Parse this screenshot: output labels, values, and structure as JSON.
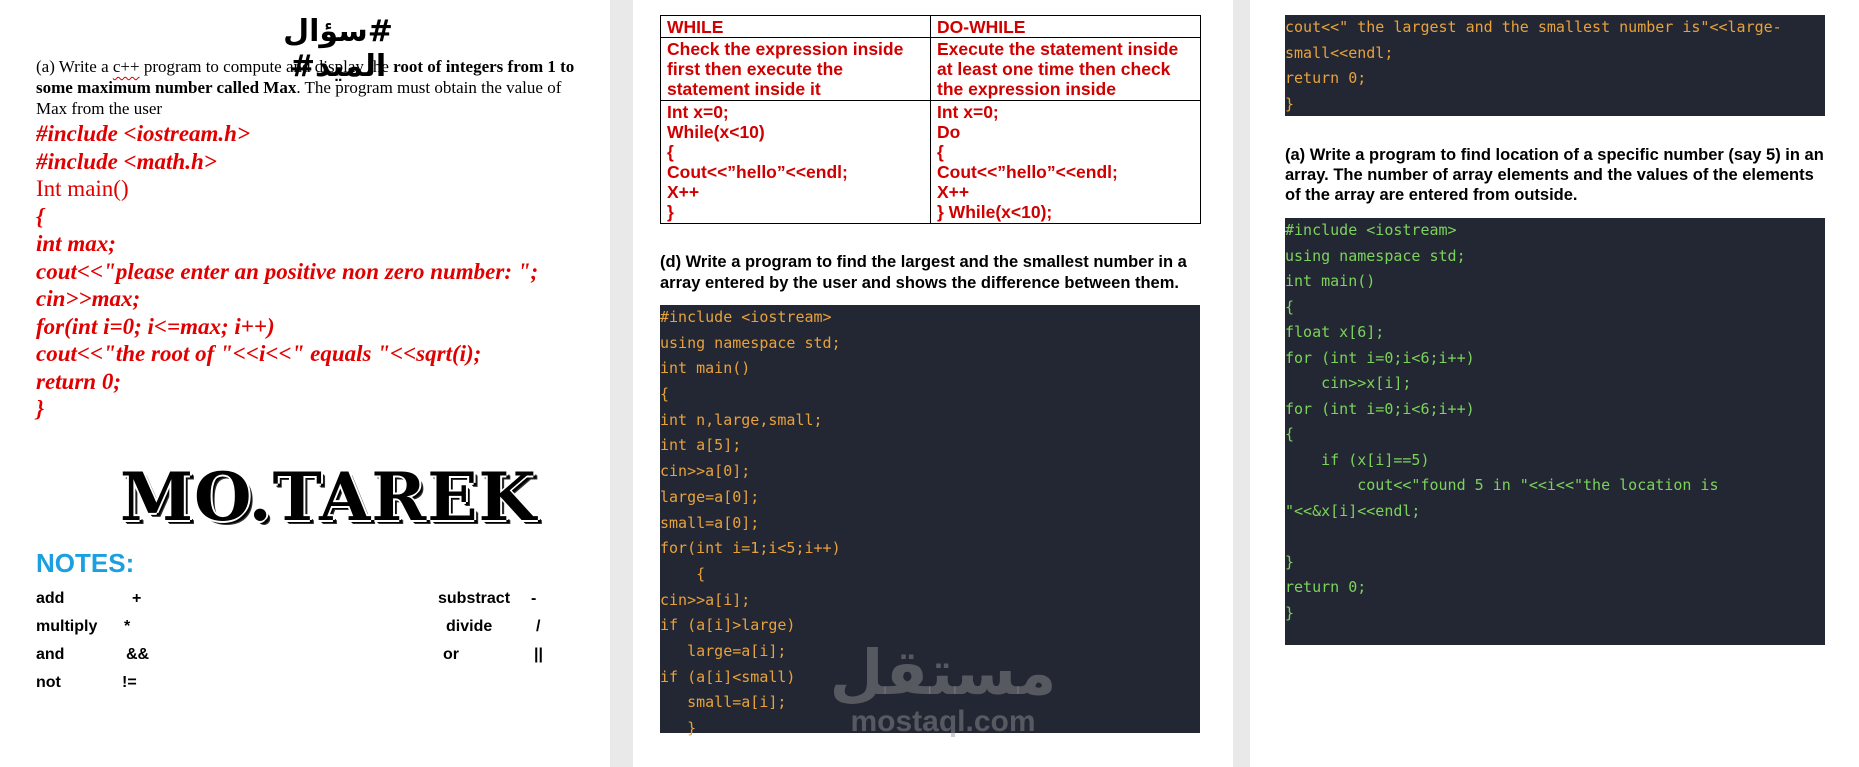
{
  "page1": {
    "arabic_title": "#سؤال الميد#",
    "question": {
      "part1": "(a) Write a ",
      "cpp": "c++",
      "part2": " program to compute and display the ",
      "bold1": "root of integers from 1 to some maximum number called Max",
      "part3": ". The program must obtain the value of Max from the user"
    },
    "code_lines": [
      "#include <iostream.h>",
      "#include <math.h>",
      "Int main()",
      "{",
      "int max;",
      "cout<<\"please enter an positive non zero number: \";",
      "cin>>max;",
      "for(int i=0; i<=max; i++)",
      "cout<<\"the root of \"<<i<<\" equals \"<<sqrt(i);",
      "return 0;",
      "}"
    ],
    "logo": "MO.TAREK",
    "notes_title": "NOTES:",
    "notes": [
      {
        "l1": "add",
        "s1": "+",
        "l2": "substract",
        "s2": "-"
      },
      {
        "l1": "multiply",
        "s1": "*",
        "l2": "divide",
        "s2": "/"
      },
      {
        "l1": "and",
        "s1": "&&",
        "l2": "or",
        "s2": "||"
      },
      {
        "l1": "not",
        "s1": "!=",
        "l2": "",
        "s2": ""
      }
    ]
  },
  "page2": {
    "table": {
      "headers": [
        "WHILE",
        "DO-WHILE"
      ],
      "rows": [
        [
          "Check the expression inside first then execute the statement inside it",
          "Execute the statement inside at least one time then check the expression inside"
        ],
        [
          "Int x=0;\nWhile(x<10)\n{\nCout<<”hello”<<endl;\nX++\n}",
          "Int x=0;\nDo\n{\nCout<<”hello”<<endl;\nX++\n} While(x<10);"
        ]
      ]
    },
    "question_d": "(d) Write a program to find the largest and the smallest number in a array entered by the user and shows the difference between them.",
    "code_lines": [
      "#include <iostream>",
      "using namespace std;",
      "int main()",
      "{",
      "int n,large,small;",
      "int a[5];",
      "cin>>a[0];",
      "large=a[0];",
      "small=a[0];",
      "for(int i=1;i<5;i++)",
      "    {",
      "cin>>a[i];",
      "if (a[i]>large)",
      "   large=a[i];",
      "if (a[i]<small)",
      "   small=a[i];",
      "   }"
    ],
    "watermark_ar": "مستقل",
    "watermark_lat": "mostaql.com"
  },
  "page3": {
    "code_top_lines": [
      "cout<<\" the largest and the smallest number is\"<<large-",
      "small<<endl;",
      "return 0;",
      "}"
    ],
    "question_a": "(a) Write a program to find location of a specific number (say 5) in an array. The number of array elements and the values of the elements of the array are entered from outside.",
    "code_lines": [
      "#include <iostream>",
      "using namespace std;",
      "int main()",
      "{",
      "float x[6];",
      "for (int i=0;i<6;i++)",
      "    cin>>x[i];",
      "for (int i=0;i<6;i++)",
      "{",
      "    if (x[i]==5)",
      "        cout<<\"found 5 in \"<<i<<\"the location is",
      "\"<<&x[i]<<endl;",
      "",
      "}",
      "return 0;",
      "}"
    ],
    "colors": {
      "code_bg": "#232733",
      "orange": "#e8a23a",
      "green": "#7cd35a"
    }
  }
}
